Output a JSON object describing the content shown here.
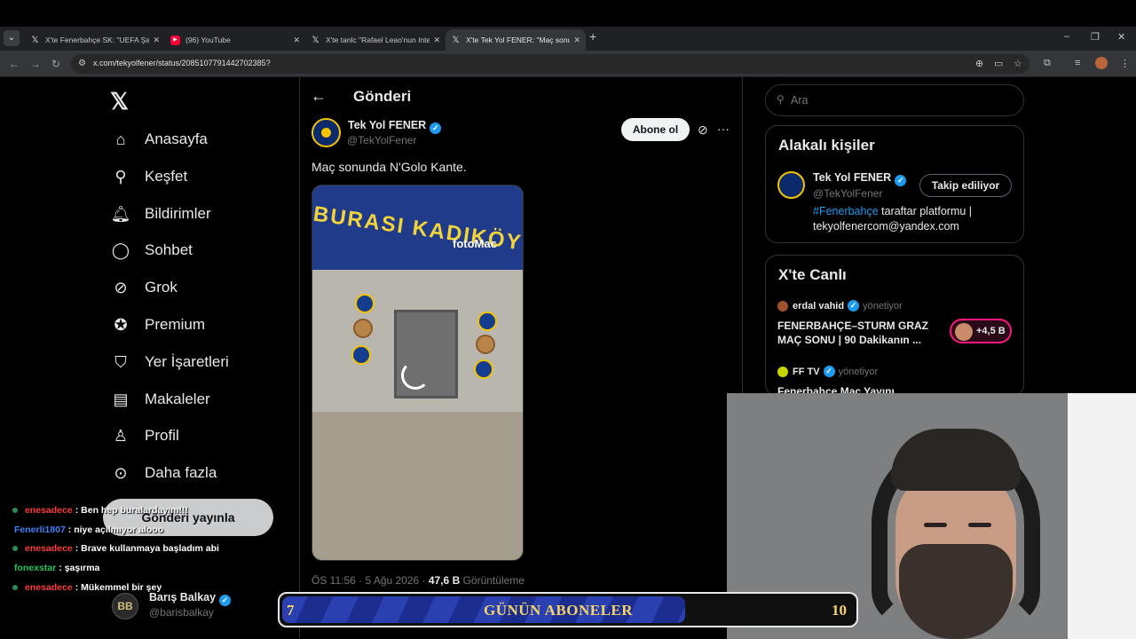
{
  "browser": {
    "tabs": [
      {
        "title": "X'te Fenerbahçe SK: \"UEFA Şam",
        "favicon": "x-icon",
        "active": false
      },
      {
        "title": "(96) YouTube",
        "favicon": "youtube-icon",
        "active": false
      },
      {
        "title": "X'te tanlc \"Rafael Leao'nun Inte",
        "favicon": "x-icon",
        "active": false
      },
      {
        "title": "X'te Tek Yol FENER: \"Maç sonu",
        "favicon": "x-icon",
        "active": true
      }
    ],
    "url": "x.com/tekyolfener/status/2085107791442702385?"
  },
  "sidebar": {
    "items": [
      {
        "label": "Anasayfa",
        "icon": "home-icon"
      },
      {
        "label": "Keşfet",
        "icon": "search-icon"
      },
      {
        "label": "Bildirimler",
        "icon": "bell-icon"
      },
      {
        "label": "Sohbet",
        "icon": "chat-icon"
      },
      {
        "label": "Grok",
        "icon": "grok-icon"
      },
      {
        "label": "Premium",
        "icon": "premium-icon"
      },
      {
        "label": "Yer İşaretleri",
        "icon": "bookmark-icon"
      },
      {
        "label": "Makaleler",
        "icon": "articles-icon"
      },
      {
        "label": "Profil",
        "icon": "person-icon"
      },
      {
        "label": "Daha fazla",
        "icon": "more-circle-icon"
      }
    ],
    "post_button": "Gönderi yayınla",
    "account": {
      "name": "Barış Balkay",
      "handle": "@barisbalkay"
    }
  },
  "post": {
    "header_title": "Gönderi",
    "author_name": "Tek Yol FENER",
    "author_handle": "@TekYolFener",
    "subscribe_label": "Abone ol",
    "text": "Maç sonunda N'Golo Kante.",
    "media": {
      "banner_text": "BURASI KADIKÖY",
      "watermark": "fotoMac"
    },
    "time": "ÖS 11:56 · 5 Ağu 2026 ·",
    "views": "47,6 B",
    "views_label": "Görüntüleme"
  },
  "right": {
    "search_placeholder": "Ara",
    "related": {
      "title": "Alakalı kişiler",
      "name": "Tek Yol FENER",
      "handle": "@TekYolFener",
      "follow_label": "Takip ediliyor",
      "bio_tag": "#Fenerbahçe",
      "bio_rest": " taraftar platformu | tekyolfenercom@yandex.com"
    },
    "live": {
      "title": "X'te Canlı",
      "items": [
        {
          "host": "erdal vahid",
          "role": "yönetiyor",
          "title": "FENERBAHÇE–STURM GRAZ MAÇ SONU | 90 Dakikanın ...",
          "listeners": "+4,5 B"
        },
        {
          "host": "FF TV",
          "role": "yönetiyor",
          "title": "Fenerbahçe Maç Yayını"
        }
      ]
    }
  },
  "overlay": {
    "chat": [
      {
        "user": "enesadece",
        "color": "#ff3b3b",
        "msg": "Ben hep buralardayım!!!"
      },
      {
        "user": "Fenerli1807",
        "color": "#3b82f6",
        "msg": "niye açılmıyor alooo"
      },
      {
        "user": "enesadece",
        "color": "#ff3b3b",
        "msg": "Brave kullanmaya başladım abi"
      },
      {
        "user": "fonexstar",
        "color": "#22c55e",
        "msg": "şaşırma"
      },
      {
        "user": "enesadece",
        "color": "#ff3b3b",
        "msg": "Mükemmel bir şey"
      }
    ],
    "sub_goal": {
      "current": "7",
      "label": "GÜNÜN ABONELER",
      "target": "10",
      "progress": 0.7
    }
  }
}
